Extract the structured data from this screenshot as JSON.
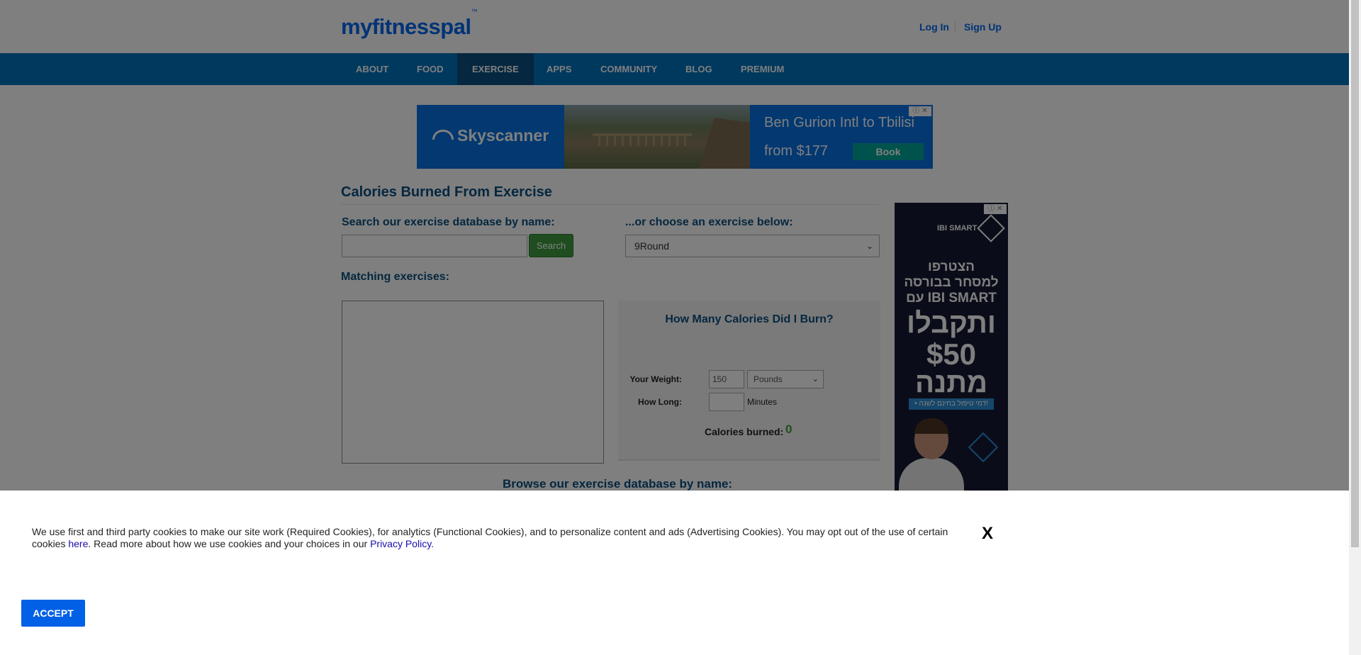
{
  "header": {
    "logo": "myfitnesspal",
    "login_label": "Log In",
    "signup_label": "Sign Up"
  },
  "nav": {
    "items": [
      "ABOUT",
      "FOOD",
      "EXERCISE",
      "APPS",
      "COMMUNITY",
      "BLOG",
      "PREMIUM"
    ],
    "active": "EXERCISE"
  },
  "ad_top": {
    "brand": "Skyscanner",
    "headline": "Ben Gurion Intl to Tbilisi",
    "price": "from $177",
    "cta": "Book"
  },
  "main": {
    "title": "Calories Burned From Exercise",
    "search_label": "Search our exercise database by name:",
    "search_value": "",
    "search_button": "Search",
    "choose_label": "...or choose an exercise below:",
    "selected_exercise": "9Round",
    "matching_label": "Matching exercises:",
    "browse_label": "Browse our exercise database by name:"
  },
  "calculator": {
    "title": "How Many Calories Did I Burn?",
    "weight_label": "Your Weight:",
    "weight_value": "150",
    "weight_unit": "Pounds",
    "duration_label": "How Long:",
    "duration_value": "",
    "duration_unit": "Minutes",
    "burned_label": "Calories burned:",
    "burned_value": "0"
  },
  "ad_side": {
    "brand": "IBI SMART",
    "line1": "הצטרפו",
    "line2": "למסחר בבורסה",
    "line3": "עם IBI SMART",
    "line4": "ותקבלו",
    "line5": "$50",
    "line6": "מתנה",
    "tag": "• דמי טיפול בחינם לשנה!"
  },
  "cookie": {
    "text_before_here": "We use first and third party cookies to make our site work (Required Cookies), for analytics (Functional Cookies), and to personalize content and ads (Advertising Cookies). You may opt out of the use of certain cookies ",
    "here_link": "here",
    "text_middle": ". Read more about how we use cookies and your choices in our ",
    "privacy_link": "Privacy Policy.",
    "close_label": "X",
    "accept_label": "ACCEPT"
  },
  "colors": {
    "nav_bg": "#0072bc",
    "nav_active": "#0b4f7f",
    "brand_blue": "#0066ee",
    "heading": "#0b4f7f",
    "green": "#3e9b3e",
    "accept_blue": "#0060e6"
  }
}
